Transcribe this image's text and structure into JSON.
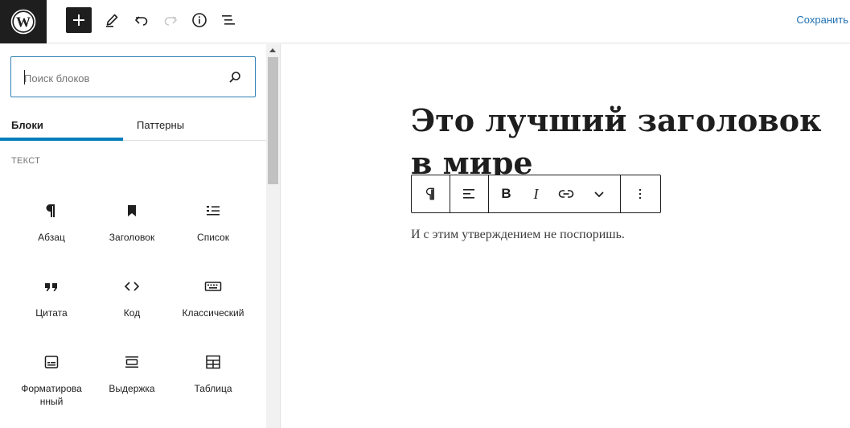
{
  "header": {
    "logo_icon": "wordpress-logo-icon",
    "add_block_icon": "plus-icon",
    "tools_icon": "pencil-icon",
    "undo_icon": "undo-icon",
    "redo_icon": "redo-icon",
    "details_icon": "info-icon",
    "list_view_icon": "list-view-icon",
    "save_label": "Сохранить"
  },
  "inserter": {
    "search": {
      "placeholder": "Поиск блоков",
      "value": ""
    },
    "tabs": [
      {
        "label": "Блоки",
        "active": true
      },
      {
        "label": "Паттерны",
        "active": false
      }
    ],
    "category": "Текст",
    "blocks": [
      {
        "label": "Абзац",
        "icon": "paragraph-icon"
      },
      {
        "label": "Заголовок",
        "icon": "bookmark-icon"
      },
      {
        "label": "Список",
        "icon": "list-icon"
      },
      {
        "label": "Цитата",
        "icon": "quote-icon"
      },
      {
        "label": "Код",
        "icon": "code-icon"
      },
      {
        "label": "Классический",
        "icon": "keyboard-icon"
      },
      {
        "label": "Форматирова нный",
        "icon": "preformatted-icon"
      },
      {
        "label": "Выдержка",
        "icon": "pullquote-icon"
      },
      {
        "label": "Таблица",
        "icon": "table-icon"
      }
    ]
  },
  "editor": {
    "heading": "Это лучший заголовок в мире",
    "paragraph": "И с этим утверждением не поспоришь.",
    "toolbar": {
      "icons": [
        "paragraph-icon",
        "align-left-icon",
        "bold-icon",
        "italic-icon",
        "link-icon",
        "chevron-down-icon",
        "more-vertical-icon"
      ]
    }
  },
  "colors": {
    "accent": "#007cba",
    "link": "#2271b1",
    "dark": "#1e1e1e"
  }
}
